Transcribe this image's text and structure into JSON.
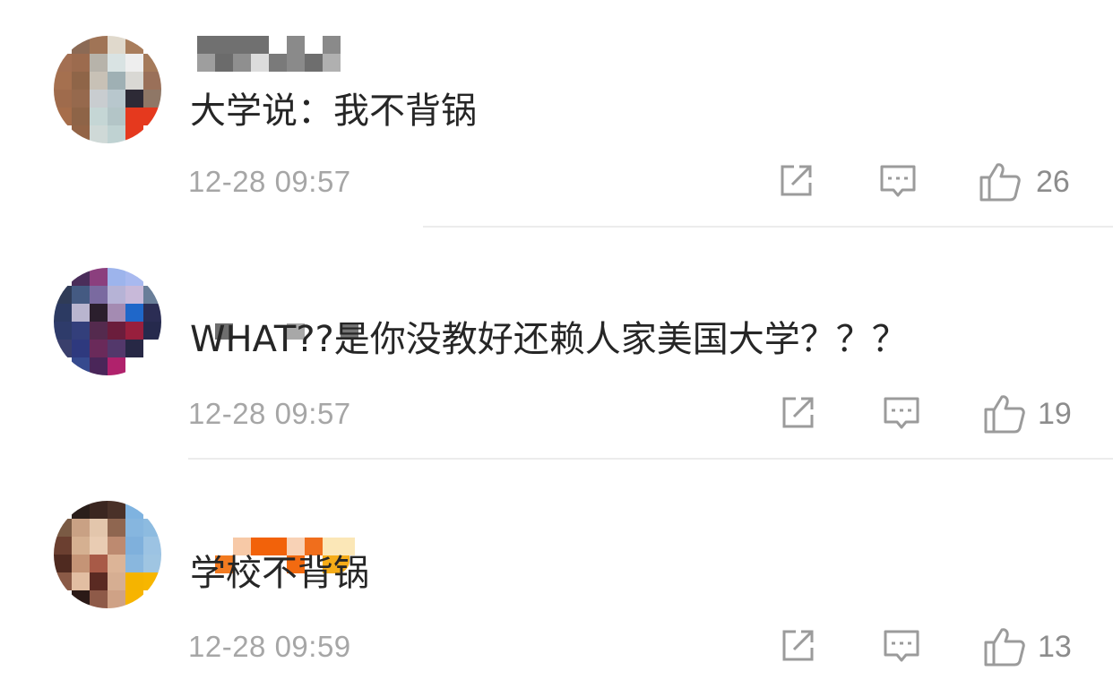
{
  "comments": [
    {
      "text": "大学说：我不背锅",
      "time": "12-28 09:57",
      "likes": "26"
    },
    {
      "text": "WHAT??是你没教好还赖人家美国大学？？？",
      "time": "12-28 09:57",
      "likes": "19"
    },
    {
      "text": "学校不背锅",
      "time": "12-28 09:59",
      "likes": "13"
    }
  ],
  "icons": {
    "share": "share-icon",
    "reply": "comment-icon",
    "like": "thumbs-up-icon"
  },
  "colors": {
    "text": "#262626",
    "meta": "#a6a6a6",
    "icon": "#9b9b9b",
    "divider": "#ececec"
  }
}
